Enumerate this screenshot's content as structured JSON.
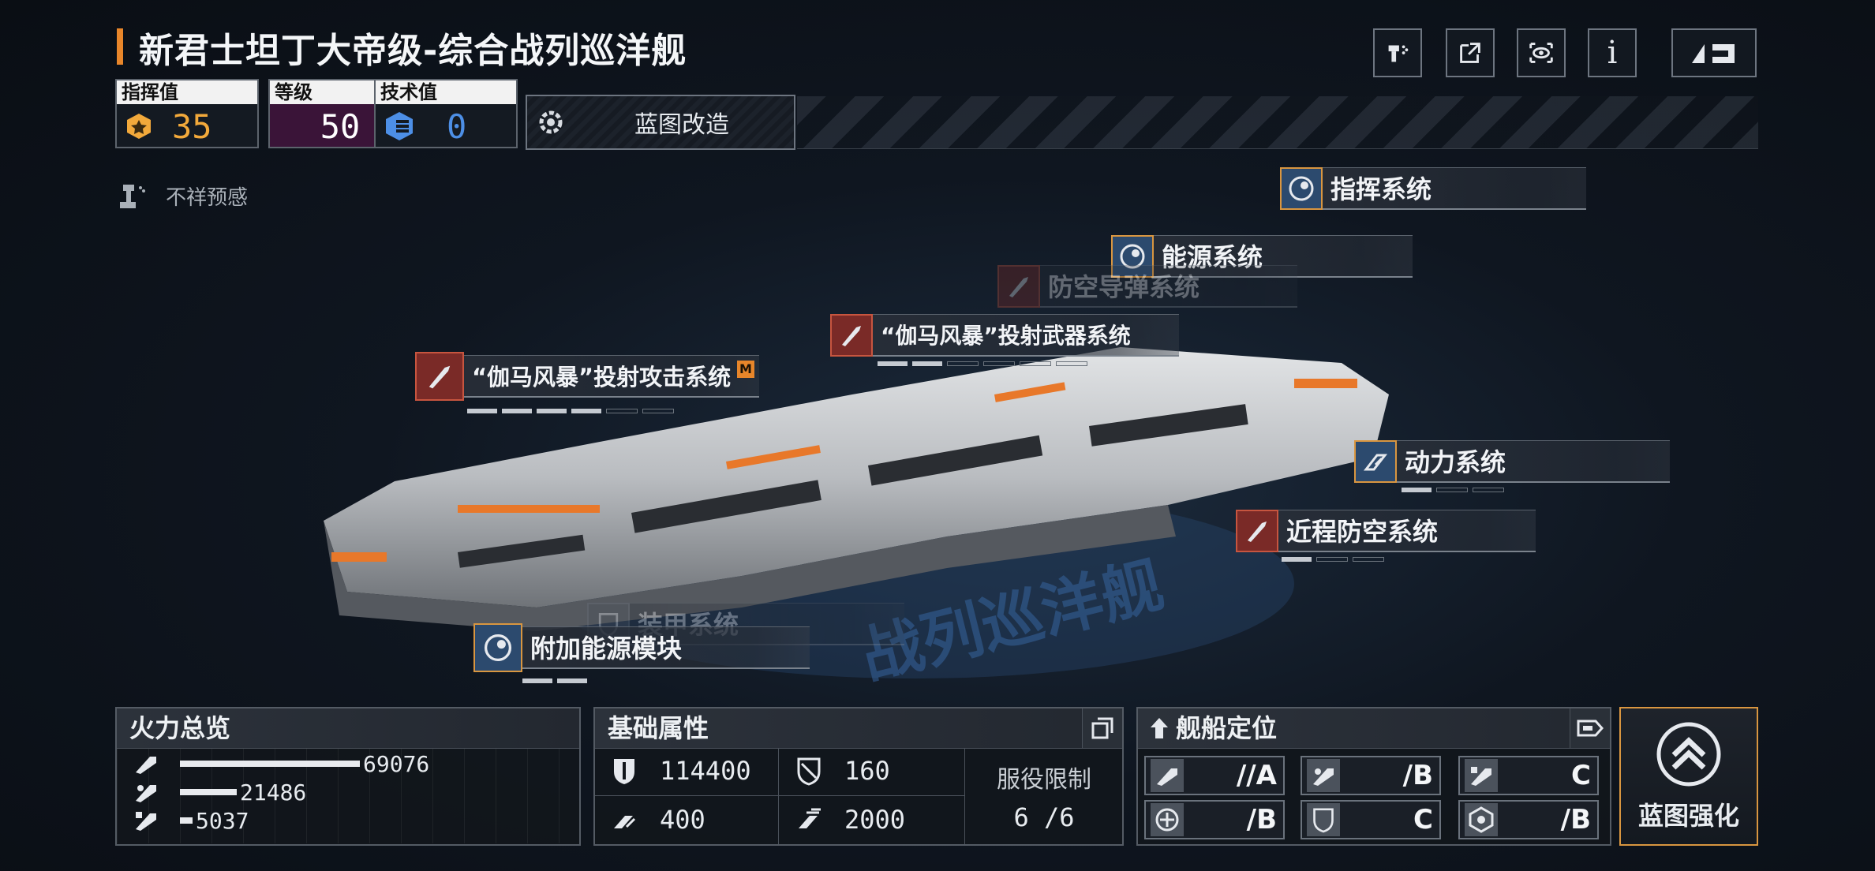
{
  "header": {
    "ship_name": "新君士坦丁大帝级-综合战列巡洋舰"
  },
  "stats": {
    "command": {
      "label": "指挥值",
      "value": "35",
      "color": "#f2a93b"
    },
    "level": {
      "label": "等级",
      "value": "50",
      "color": "#ffffff"
    },
    "tech": {
      "label": "技术值",
      "value": "0",
      "color": "#4d8fe6"
    }
  },
  "blueprint_mod": {
    "label": "蓝图改造"
  },
  "omen": {
    "label": "不祥预感"
  },
  "modules": [
    {
      "label": "指挥系统",
      "type": "blue"
    },
    {
      "label": "能源系统",
      "type": "blue"
    },
    {
      "label": "防空导弹系统",
      "type": "red"
    },
    {
      "label": "“伽马风暴”投射武器系统",
      "type": "red"
    },
    {
      "label": "“伽马风暴”投射攻击系统",
      "type": "red",
      "badge": "M"
    },
    {
      "label": "动力系统",
      "type": "blue"
    },
    {
      "label": "近程防空系统",
      "type": "red"
    },
    {
      "label": "装甲系统",
      "type": "gray"
    },
    {
      "label": "附加能源模块",
      "type": "blue"
    }
  ],
  "firepower": {
    "title": "火力总览",
    "rows": [
      {
        "value": "69076",
        "fraction": 1.0
      },
      {
        "value": "21486",
        "fraction": 0.31
      },
      {
        "value": "5037",
        "fraction": 0.07
      }
    ]
  },
  "base_attrs": {
    "title": "基础属性",
    "armor": "114400",
    "shield": "160",
    "speed": "400",
    "range": "2000",
    "service_limit_label": "服役限制",
    "service_limit_value": "6 /6"
  },
  "positioning": {
    "title": "舰船定位",
    "cells": [
      "//A",
      "/B",
      "C",
      "/B",
      "C",
      "/B"
    ]
  },
  "enhance": {
    "label": "蓝图强化"
  },
  "colors": {
    "accent": "#e8862a",
    "module_blue": "#2c4a6e",
    "module_red": "#7a2a27"
  }
}
